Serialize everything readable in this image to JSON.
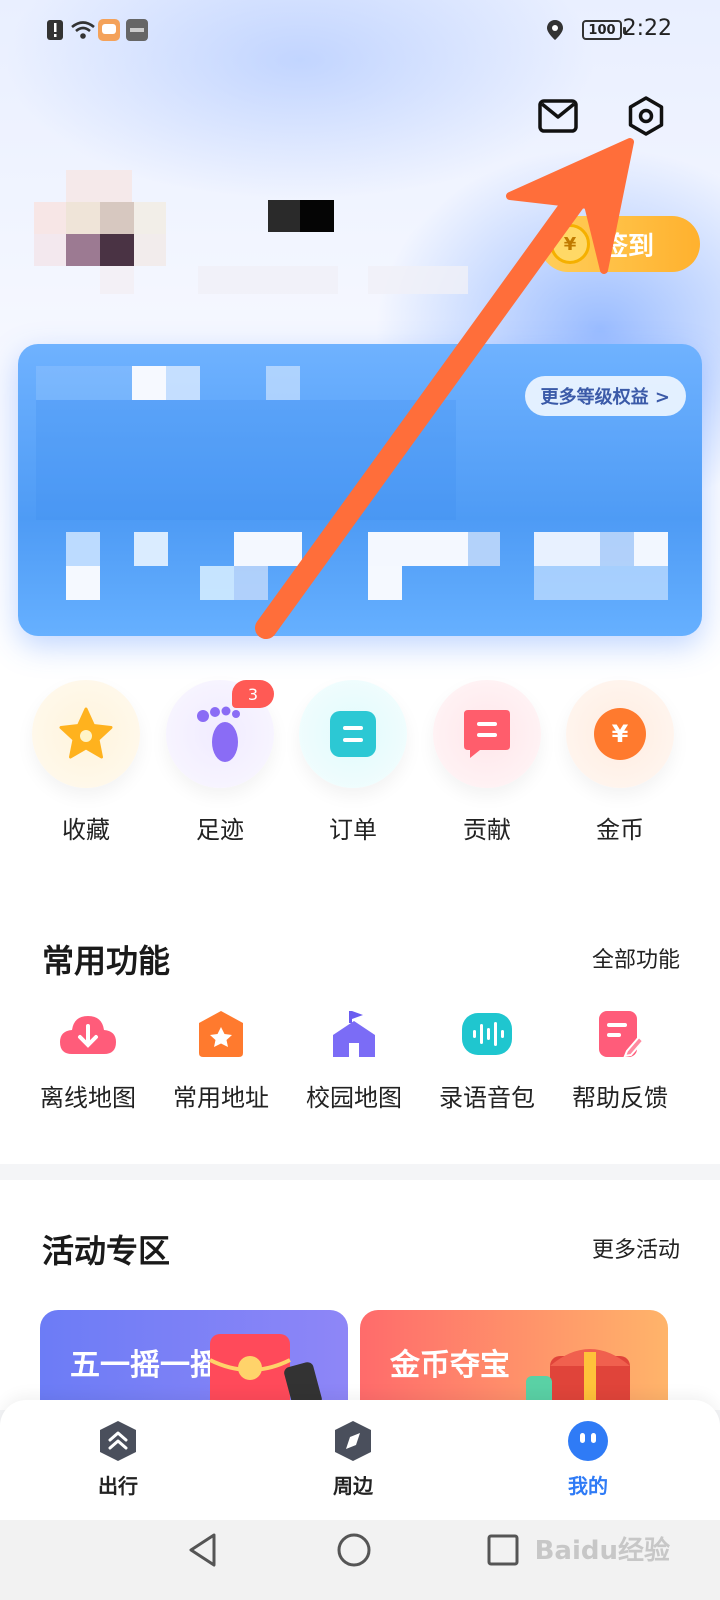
{
  "status_bar": {
    "time": "2:22",
    "battery": "100",
    "icons": [
      "alert-icon",
      "wifi-icon",
      "message-icon",
      "hms-icon",
      "location-icon"
    ]
  },
  "header": {
    "icons": [
      "mail-icon",
      "settings-icon"
    ]
  },
  "profile": {
    "signin_label": "签到",
    "signin_icon": "coin-icon"
  },
  "level_card": {
    "more_benefits": "更多等级权益 >"
  },
  "quick_items": [
    {
      "label": "收藏",
      "icon": "star-icon",
      "color": "#ffb21e"
    },
    {
      "label": "足迹",
      "icon": "footprint-icon",
      "color": "#8a6cf5",
      "badge": "3"
    },
    {
      "label": "订单",
      "icon": "order-icon",
      "color": "#2cc8d4"
    },
    {
      "label": "贡献",
      "icon": "contribution-icon",
      "color": "#ff5d6c"
    },
    {
      "label": "金币",
      "icon": "coin-icon",
      "color": "#ff7a2e"
    }
  ],
  "common_functions": {
    "title": "常用功能",
    "more": "全部功能",
    "items": [
      {
        "label": "离线地图",
        "icon": "cloud-download-icon"
      },
      {
        "label": "常用地址",
        "icon": "home-star-icon"
      },
      {
        "label": "校园地图",
        "icon": "campus-icon"
      },
      {
        "label": "录语音包",
        "icon": "voice-icon"
      },
      {
        "label": "帮助反馈",
        "icon": "feedback-icon"
      }
    ]
  },
  "activities": {
    "title": "活动专区",
    "more": "更多活动",
    "cards": [
      {
        "title": "五一摇一摇"
      },
      {
        "title": "金币夺宝"
      }
    ]
  },
  "bottom_nav": [
    {
      "label": "出行",
      "icon": "travel-icon"
    },
    {
      "label": "周边",
      "icon": "compass-icon"
    },
    {
      "label": "我的",
      "icon": "profile-icon",
      "active": true
    }
  ],
  "system_nav": [
    "back-icon",
    "home-icon",
    "recents-icon"
  ],
  "watermark": "Baidu经验",
  "colors": {
    "accent": "#2f7bf6",
    "arrow": "#ff6e3a",
    "signin": "#ffb12e"
  }
}
